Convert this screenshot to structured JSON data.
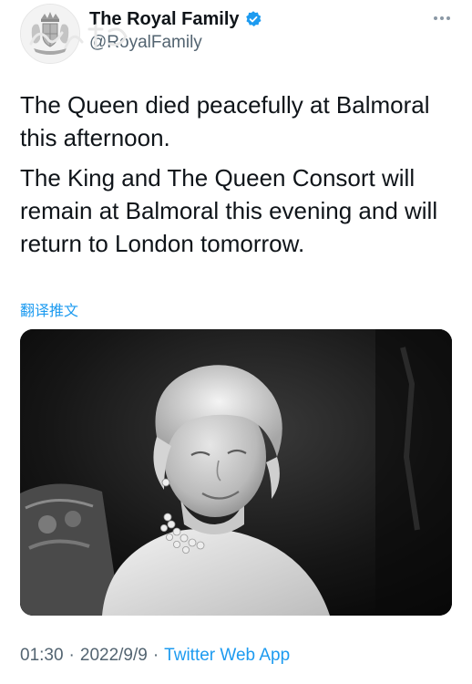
{
  "author": {
    "display_name": "The Royal Family",
    "handle": "@RoyalFamily",
    "verified": true,
    "avatar_icon": "royal-coat-of-arms-icon",
    "verified_icon": "verified-badge-icon",
    "more_icon": "more-options-icon"
  },
  "tweet": {
    "paragraphs": [
      "The Queen died peacefully at Balmoral this afternoon.",
      "The King and The Queen Consort will remain at Balmoral this evening and will return to London tomorrow."
    ],
    "translate_label": "翻译推文"
  },
  "media": {
    "type": "black-and-white-portrait-photo"
  },
  "meta": {
    "time": "01:30",
    "separator": "·",
    "date": "2022/9/9",
    "source": "Twitter Web App"
  },
  "colors": {
    "accent": "#1d9bf0",
    "text": "#0f1419",
    "secondary": "#536471"
  }
}
